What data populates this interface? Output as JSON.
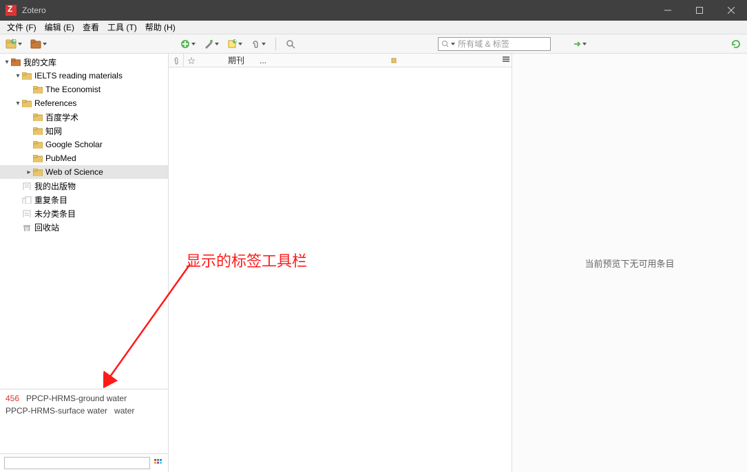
{
  "title": "Zotero",
  "menubar": [
    "文件 (F)",
    "编辑 (E)",
    "查看",
    "工具 (T)",
    "帮助 (H)"
  ],
  "search_placeholder": "所有域 & 标签",
  "tree": [
    {
      "indent": 0,
      "toggle": "▾",
      "icon": "lib",
      "label": "我的文库",
      "sel": false
    },
    {
      "indent": 1,
      "toggle": "▾",
      "icon": "folder",
      "label": "IELTS reading materials",
      "sel": false
    },
    {
      "indent": 2,
      "toggle": "",
      "icon": "folder",
      "label": "The Economist",
      "sel": false
    },
    {
      "indent": 1,
      "toggle": "▾",
      "icon": "folder",
      "label": "References",
      "sel": false
    },
    {
      "indent": 2,
      "toggle": "",
      "icon": "folder",
      "label": "百度学术",
      "sel": false
    },
    {
      "indent": 2,
      "toggle": "",
      "icon": "folder",
      "label": "知网",
      "sel": false
    },
    {
      "indent": 2,
      "toggle": "",
      "icon": "folder",
      "label": "Google Scholar",
      "sel": false
    },
    {
      "indent": 2,
      "toggle": "",
      "icon": "folder",
      "label": "PubMed",
      "sel": false
    },
    {
      "indent": 2,
      "toggle": "▸",
      "icon": "folder",
      "label": "Web of Science",
      "sel": true
    },
    {
      "indent": 1,
      "toggle": "",
      "icon": "pub",
      "label": "我的出版物",
      "sel": false
    },
    {
      "indent": 1,
      "toggle": "",
      "icon": "dup",
      "label": "重复条目",
      "sel": false
    },
    {
      "indent": 1,
      "toggle": "",
      "icon": "unfiled",
      "label": "未分类条目",
      "sel": false
    },
    {
      "indent": 1,
      "toggle": "",
      "icon": "trash",
      "label": "回收站",
      "sel": false
    }
  ],
  "tags": [
    {
      "text": "456",
      "cls": "red"
    },
    {
      "text": "PPCP-HRMS-ground water",
      "cls": ""
    },
    {
      "text": "PPCP-HRMS-surface water",
      "cls": ""
    },
    {
      "text": "water",
      "cls": ""
    }
  ],
  "items_header": {
    "publication": "期刊",
    "ellipsis": "..."
  },
  "right_message": "当前预览下无可用条目",
  "annotation": "显示的标签工具栏"
}
